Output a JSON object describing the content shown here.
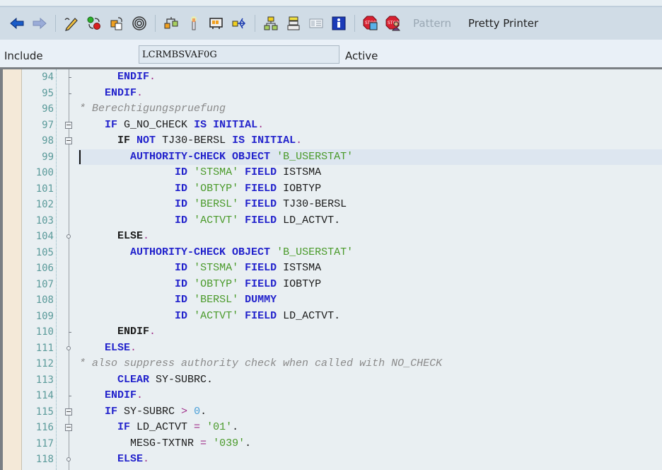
{
  "toolbar": {
    "buttons": [
      {
        "icon": "back-arrow-icon",
        "tooltip": "Back"
      },
      {
        "icon": "forward-arrow-icon",
        "tooltip": "Forward"
      },
      {
        "icon": "display-change-icon",
        "tooltip": "Display <-> Change"
      },
      {
        "icon": "active-inactive-icon",
        "tooltip": "Active <-> Inactive"
      },
      {
        "icon": "other-object-icon",
        "tooltip": "Other Object"
      },
      {
        "icon": "check-icon",
        "tooltip": "Check"
      },
      {
        "icon": "activate-icon",
        "tooltip": "Activate"
      },
      {
        "icon": "test-icon",
        "tooltip": "Test"
      },
      {
        "icon": "where-used-icon",
        "tooltip": "Where-Used List"
      },
      {
        "icon": "navigate-icon",
        "tooltip": "Navigate"
      },
      {
        "icon": "object-list-icon",
        "tooltip": "Object List"
      },
      {
        "icon": "navigation-stack-icon",
        "tooltip": "Navigation Stack"
      },
      {
        "icon": "window-icon",
        "tooltip": "Display Object Window"
      },
      {
        "icon": "info-icon",
        "tooltip": "Information"
      },
      {
        "icon": "breakpoint-session-icon",
        "tooltip": "Set Session Breakpoint"
      },
      {
        "icon": "breakpoint-user-icon",
        "tooltip": "Set External Breakpoint"
      }
    ],
    "pattern_label": "Pattern",
    "pretty_printer_label": "Pretty Printer"
  },
  "include": {
    "label": "Include",
    "value": "LCRMBSVAF0G",
    "status": "Active"
  },
  "editor": {
    "current_line": 99,
    "lines": [
      {
        "n": "94",
        "fold": "tick",
        "tokens": [
          {
            "t": "      "
          },
          {
            "t": "ENDIF",
            "c": "kw"
          },
          {
            "t": ".",
            "c": "op"
          }
        ]
      },
      {
        "n": "95",
        "fold": "tick",
        "tokens": [
          {
            "t": "    "
          },
          {
            "t": "ENDIF",
            "c": "kw"
          },
          {
            "t": ".",
            "c": "op"
          }
        ]
      },
      {
        "n": "96",
        "fold": "",
        "tokens": [
          {
            "t": "* Berechtigungspruefung",
            "c": "cmt"
          }
        ]
      },
      {
        "n": "97",
        "fold": "box",
        "tokens": [
          {
            "t": "    "
          },
          {
            "t": "IF",
            "c": "kw"
          },
          {
            "t": " G_NO_CHECK "
          },
          {
            "t": "IS INITIAL",
            "c": "kw"
          },
          {
            "t": ".",
            "c": "op"
          }
        ]
      },
      {
        "n": "98",
        "fold": "box",
        "tokens": [
          {
            "t": "      "
          },
          {
            "t": "IF",
            "c": "kw2"
          },
          {
            "t": " "
          },
          {
            "t": "NOT",
            "c": "kw"
          },
          {
            "t": " TJ30-BERSL "
          },
          {
            "t": "IS INITIAL",
            "c": "kw"
          },
          {
            "t": ".",
            "c": "op"
          }
        ]
      },
      {
        "n": "99",
        "fold": "",
        "tokens": [
          {
            "t": "        "
          },
          {
            "t": "AUTHORITY-CHECK OBJECT",
            "c": "kw"
          },
          {
            "t": " "
          },
          {
            "t": "'B_USERSTAT'",
            "c": "str"
          }
        ]
      },
      {
        "n": "100",
        "fold": "",
        "tokens": [
          {
            "t": "               "
          },
          {
            "t": "ID",
            "c": "kw"
          },
          {
            "t": " "
          },
          {
            "t": "'STSMA'",
            "c": "str"
          },
          {
            "t": " "
          },
          {
            "t": "FIELD",
            "c": "kw"
          },
          {
            "t": " ISTSMA"
          }
        ]
      },
      {
        "n": "101",
        "fold": "",
        "tokens": [
          {
            "t": "               "
          },
          {
            "t": "ID",
            "c": "kw"
          },
          {
            "t": " "
          },
          {
            "t": "'OBTYP'",
            "c": "str"
          },
          {
            "t": " "
          },
          {
            "t": "FIELD",
            "c": "kw"
          },
          {
            "t": " IOBTYP"
          }
        ]
      },
      {
        "n": "102",
        "fold": "",
        "tokens": [
          {
            "t": "               "
          },
          {
            "t": "ID",
            "c": "kw"
          },
          {
            "t": " "
          },
          {
            "t": "'BERSL'",
            "c": "str"
          },
          {
            "t": " "
          },
          {
            "t": "FIELD",
            "c": "kw"
          },
          {
            "t": " TJ30-BERSL"
          }
        ]
      },
      {
        "n": "103",
        "fold": "",
        "tokens": [
          {
            "t": "               "
          },
          {
            "t": "ID",
            "c": "kw"
          },
          {
            "t": " "
          },
          {
            "t": "'ACTVT'",
            "c": "str"
          },
          {
            "t": " "
          },
          {
            "t": "FIELD",
            "c": "kw"
          },
          {
            "t": " LD_ACTVT."
          }
        ]
      },
      {
        "n": "104",
        "fold": "circle",
        "tokens": [
          {
            "t": "      "
          },
          {
            "t": "ELSE",
            "c": "kw2"
          },
          {
            "t": ".",
            "c": "op"
          }
        ]
      },
      {
        "n": "105",
        "fold": "",
        "tokens": [
          {
            "t": "        "
          },
          {
            "t": "AUTHORITY-CHECK OBJECT",
            "c": "kw"
          },
          {
            "t": " "
          },
          {
            "t": "'B_USERSTAT'",
            "c": "str"
          }
        ]
      },
      {
        "n": "106",
        "fold": "",
        "tokens": [
          {
            "t": "               "
          },
          {
            "t": "ID",
            "c": "kw"
          },
          {
            "t": " "
          },
          {
            "t": "'STSMA'",
            "c": "str"
          },
          {
            "t": " "
          },
          {
            "t": "FIELD",
            "c": "kw"
          },
          {
            "t": " ISTSMA"
          }
        ]
      },
      {
        "n": "107",
        "fold": "",
        "tokens": [
          {
            "t": "               "
          },
          {
            "t": "ID",
            "c": "kw"
          },
          {
            "t": " "
          },
          {
            "t": "'OBTYP'",
            "c": "str"
          },
          {
            "t": " "
          },
          {
            "t": "FIELD",
            "c": "kw"
          },
          {
            "t": " IOBTYP"
          }
        ]
      },
      {
        "n": "108",
        "fold": "",
        "tokens": [
          {
            "t": "               "
          },
          {
            "t": "ID",
            "c": "kw"
          },
          {
            "t": " "
          },
          {
            "t": "'BERSL'",
            "c": "str"
          },
          {
            "t": " "
          },
          {
            "t": "DUMMY",
            "c": "kw"
          }
        ]
      },
      {
        "n": "109",
        "fold": "",
        "tokens": [
          {
            "t": "               "
          },
          {
            "t": "ID",
            "c": "kw"
          },
          {
            "t": " "
          },
          {
            "t": "'ACTVT'",
            "c": "str"
          },
          {
            "t": " "
          },
          {
            "t": "FIELD",
            "c": "kw"
          },
          {
            "t": " LD_ACTVT."
          }
        ]
      },
      {
        "n": "110",
        "fold": "tick",
        "tokens": [
          {
            "t": "      "
          },
          {
            "t": "ENDIF",
            "c": "kw2"
          },
          {
            "t": ".",
            "c": "op"
          }
        ]
      },
      {
        "n": "111",
        "fold": "circle",
        "tokens": [
          {
            "t": "    "
          },
          {
            "t": "ELSE",
            "c": "kw"
          },
          {
            "t": ".",
            "c": "op"
          }
        ]
      },
      {
        "n": "112",
        "fold": "",
        "tokens": [
          {
            "t": "* also suppress authority check when called with NO_CHECK",
            "c": "cmt"
          }
        ]
      },
      {
        "n": "113",
        "fold": "",
        "tokens": [
          {
            "t": "      "
          },
          {
            "t": "CLEAR",
            "c": "kw"
          },
          {
            "t": " SY-SUBRC."
          }
        ]
      },
      {
        "n": "114",
        "fold": "tick",
        "tokens": [
          {
            "t": "    "
          },
          {
            "t": "ENDIF",
            "c": "kw"
          },
          {
            "t": ".",
            "c": "op"
          }
        ]
      },
      {
        "n": "115",
        "fold": "box",
        "tokens": [
          {
            "t": "    "
          },
          {
            "t": "IF",
            "c": "kw"
          },
          {
            "t": " SY-SUBRC "
          },
          {
            "t": ">",
            "c": "op"
          },
          {
            "t": " "
          },
          {
            "t": "0",
            "c": "num"
          },
          {
            "t": "."
          }
        ]
      },
      {
        "n": "116",
        "fold": "box",
        "tokens": [
          {
            "t": "      "
          },
          {
            "t": "IF",
            "c": "kw"
          },
          {
            "t": " LD_ACTVT "
          },
          {
            "t": "=",
            "c": "op"
          },
          {
            "t": " "
          },
          {
            "t": "'01'",
            "c": "str"
          },
          {
            "t": "."
          }
        ]
      },
      {
        "n": "117",
        "fold": "",
        "tokens": [
          {
            "t": "        MESG-TXTNR "
          },
          {
            "t": "=",
            "c": "op"
          },
          {
            "t": " "
          },
          {
            "t": "'039'",
            "c": "str"
          },
          {
            "t": "."
          }
        ]
      },
      {
        "n": "118",
        "fold": "circle",
        "tokens": [
          {
            "t": "      "
          },
          {
            "t": "ELSE",
            "c": "kw"
          },
          {
            "t": ".",
            "c": "op"
          }
        ]
      }
    ]
  }
}
